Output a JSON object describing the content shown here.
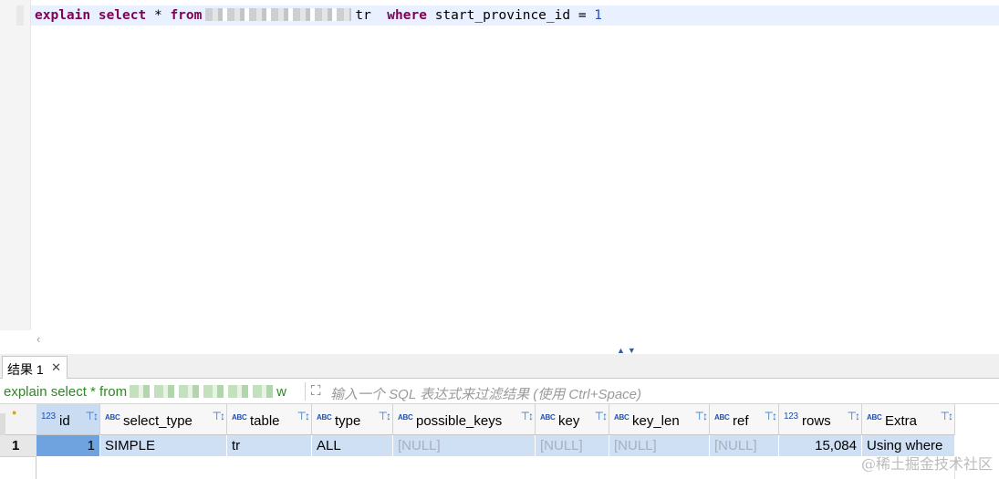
{
  "editor": {
    "code": {
      "kw_explain": "explain",
      "kw_select": "select",
      "star": "*",
      "kw_from": "from",
      "alias": "tr",
      "kw_where": "where",
      "condition": "start_province_id =",
      "value": "1"
    },
    "scroll_left_glyph": "‹",
    "splitter_glyph": "▲▼"
  },
  "tabs": [
    {
      "label": "结果 1",
      "close": "✕"
    }
  ],
  "filter": {
    "query_prefix": "explain select * from",
    "query_suffix": "w",
    "placeholder": "输入一个 SQL 表达式来过滤结果 (使用 Ctrl+Space)",
    "icon": "expand-icon"
  },
  "grid": {
    "columns": [
      {
        "name": "id",
        "type": "123"
      },
      {
        "name": "select_type",
        "type": "ABC"
      },
      {
        "name": "table",
        "type": "ABC"
      },
      {
        "name": "type",
        "type": "ABC"
      },
      {
        "name": "possible_keys",
        "type": "ABC"
      },
      {
        "name": "key",
        "type": "ABC"
      },
      {
        "name": "key_len",
        "type": "ABC"
      },
      {
        "name": "ref",
        "type": "ABC"
      },
      {
        "name": "rows",
        "type": "123"
      },
      {
        "name": "Extra",
        "type": "ABC"
      }
    ],
    "rows": [
      {
        "num": "1",
        "cells": [
          "1",
          "SIMPLE",
          "tr",
          "ALL",
          "[NULL]",
          "[NULL]",
          "[NULL]",
          "[NULL]",
          "15,084",
          "Using where"
        ]
      }
    ],
    "filter_glyph": "⊤↕",
    "lock_glyph": "●"
  },
  "watermark": "@稀土掘金技术社区"
}
